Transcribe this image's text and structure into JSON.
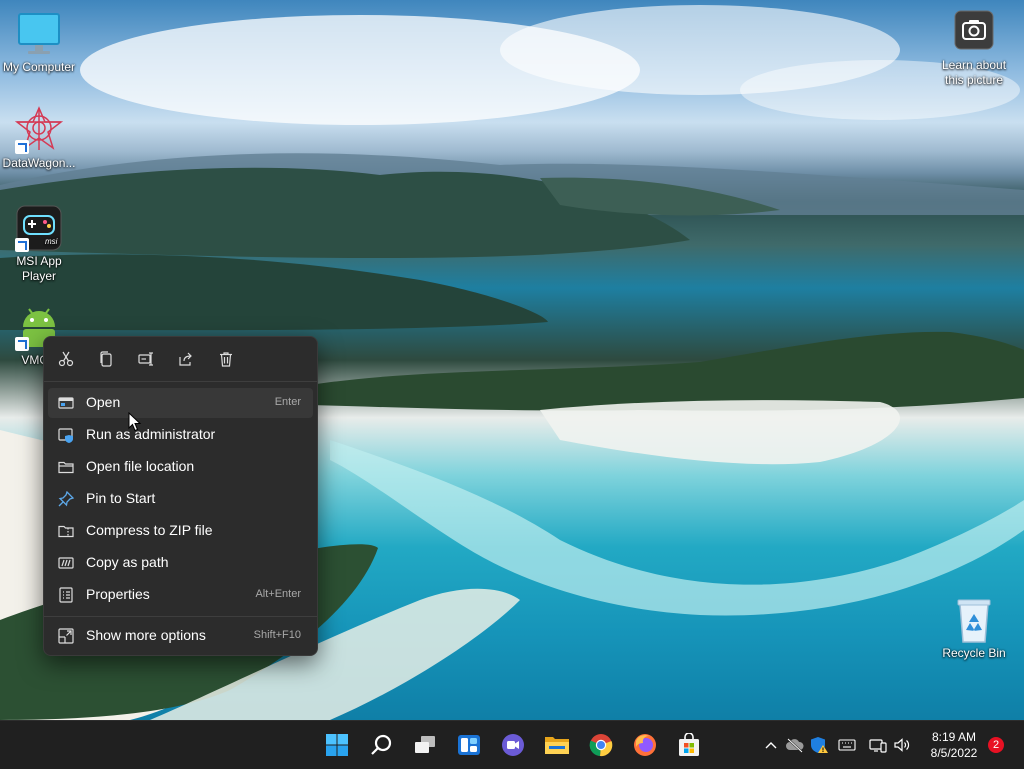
{
  "desktop": {
    "icons": [
      {
        "label": "My Computer",
        "icon": "monitor-icon",
        "shortcut": false
      },
      {
        "label": "DataWagon...",
        "icon": "datawagon-app-icon",
        "shortcut": true
      },
      {
        "label": "MSI App Player",
        "icon": "msi-gamepad-icon",
        "shortcut": true
      },
      {
        "label": "VMOS",
        "icon": "android-robot-icon",
        "shortcut": true
      },
      {
        "label": "Learn about this picture",
        "icon": "camera-icon",
        "shortcut": false
      },
      {
        "label": "Recycle Bin",
        "icon": "recycle-bin-icon",
        "shortcut": false
      }
    ]
  },
  "context_menu": {
    "toolbar": [
      {
        "name": "Cut",
        "icon": "cut-icon"
      },
      {
        "name": "Copy",
        "icon": "copy-icon"
      },
      {
        "name": "Rename",
        "icon": "rename-icon"
      },
      {
        "name": "Share",
        "icon": "share-icon"
      },
      {
        "name": "Delete",
        "icon": "delete-icon"
      }
    ],
    "items": [
      {
        "label": "Open",
        "accel": "Enter",
        "icon": "open-window-icon",
        "highlighted": true
      },
      {
        "label": "Run as administrator",
        "accel": "",
        "icon": "shield-window-icon"
      },
      {
        "label": "Open file location",
        "accel": "",
        "icon": "folder-icon"
      },
      {
        "label": "Pin to Start",
        "accel": "",
        "icon": "pin-icon"
      },
      {
        "label": "Compress to ZIP file",
        "accel": "",
        "icon": "zip-folder-icon"
      },
      {
        "label": "Copy as path",
        "accel": "",
        "icon": "copy-path-icon"
      },
      {
        "label": "Properties",
        "accel": "Alt+Enter",
        "icon": "properties-icon"
      },
      {
        "label": "Show more options",
        "accel": "Shift+F10",
        "icon": "more-options-icon"
      }
    ]
  },
  "taskbar": {
    "apps": [
      "start-icon",
      "search-icon",
      "task-view-icon",
      "widgets-icon",
      "teams-chat-icon",
      "file-explorer-icon",
      "chrome-icon",
      "firefox-icon",
      "microsoft-store-icon"
    ],
    "tray": [
      "chevron-up-icon",
      "onedrive-icon",
      "security-warning-icon",
      "keyboard-icon",
      "network-icon",
      "volume-icon"
    ],
    "time": "8:19 AM",
    "date": "8/5/2022",
    "notification_count": "2"
  },
  "colors": {
    "accent": "#0078d4",
    "menu_bg": "#2c2c2c",
    "taskbar_bg": "#202020",
    "badge": "#e81123"
  }
}
